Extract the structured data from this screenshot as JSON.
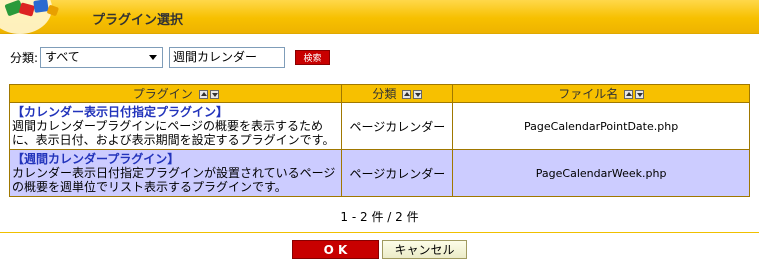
{
  "header": {
    "title": "プラグイン選択"
  },
  "filter": {
    "category_label": "分類:",
    "category_value": "すべて",
    "search_value": "週間カレンダー",
    "search_button": "検索"
  },
  "table": {
    "headers": {
      "plugin": "プラグイン",
      "category": "分類",
      "file": "ファイル名"
    },
    "rows": [
      {
        "name": "【カレンダー表示日付指定プラグイン】",
        "description": "週間カレンダープラグインにページの概要を表示するために、表示日付、および表示期間を設定するプラグインです。",
        "category": "ページカレンダー",
        "file": "PageCalendarPointDate.php"
      },
      {
        "name": "【週間カレンダープラグイン】",
        "description": "カレンダー表示日付指定プラグインが設置されているページの概要を週単位でリスト表示するプラグインです。",
        "category": "ページカレンダー",
        "file": "PageCalendarWeek.php"
      }
    ]
  },
  "pager": {
    "text": "1 - 2 件 / 2 件"
  },
  "footer": {
    "ok": "O K",
    "cancel": "キャンセル"
  },
  "colors": {
    "header": "#f7c000",
    "selected_row": "#ccccff",
    "ok_button": "#c80000",
    "link": "#2233bb"
  }
}
